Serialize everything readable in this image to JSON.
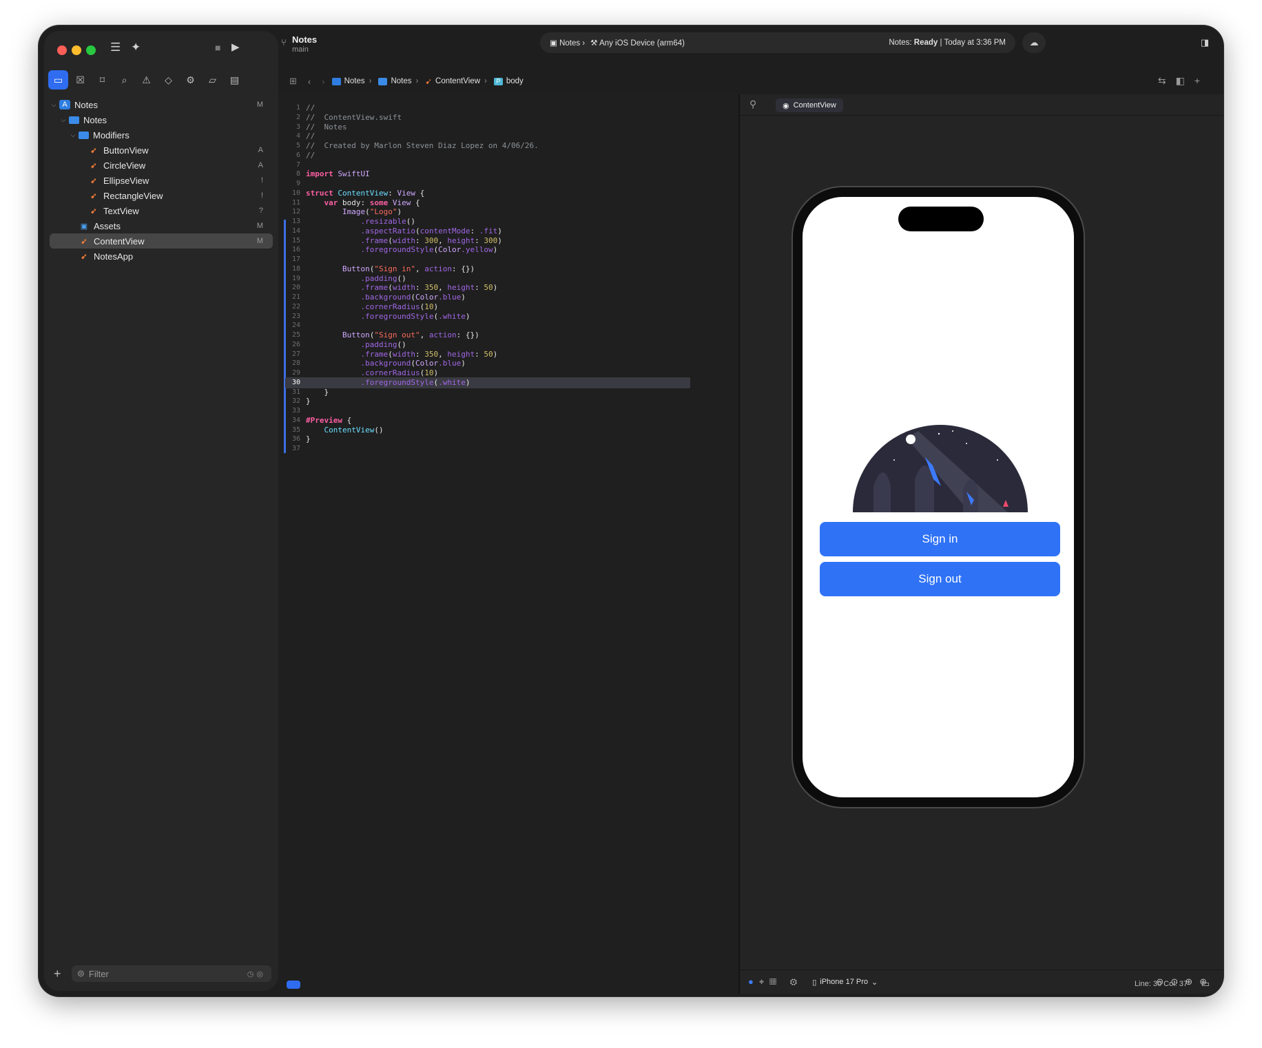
{
  "window": {
    "title": "Notes"
  },
  "toolbar": {
    "scheme_name": "Notes",
    "branch": "main",
    "target_app": "Notes",
    "destination": "Any iOS Device (arm64)",
    "status_prefix": "Notes:",
    "status_state": "Ready",
    "status_time": "| Today at 3:36 PM"
  },
  "navigator": {
    "items": [
      {
        "label": "Notes",
        "badge": "M"
      },
      {
        "label": "Notes",
        "badge": ""
      },
      {
        "label": "Modifiers",
        "badge": ""
      },
      {
        "label": "ButtonView",
        "badge": "A"
      },
      {
        "label": "CircleView",
        "badge": "A"
      },
      {
        "label": "EllipseView",
        "badge": "!"
      },
      {
        "label": "RectangleView",
        "badge": "!"
      },
      {
        "label": "TextView",
        "badge": "?"
      },
      {
        "label": "Assets",
        "badge": "M"
      },
      {
        "label": "ContentView",
        "badge": "M"
      },
      {
        "label": "NotesApp",
        "badge": ""
      }
    ],
    "filter_placeholder": "Filter"
  },
  "jumpbar": {
    "crumbs": [
      "Notes",
      "Notes",
      "ContentView",
      "body"
    ]
  },
  "editor": {
    "current_line": "30",
    "lines": [
      "//",
      "//  ContentView.swift",
      "//  Notes",
      "//",
      "//  Created by Marlon Steven Diaz Lopez on 4/06/26.",
      "//",
      "",
      "import SwiftUI",
      "",
      "struct ContentView: View {",
      "    var body: some View {",
      "        Image(\"Logo\")",
      "            .resizable()",
      "            .aspectRatio(contentMode: .fit)",
      "            .frame(width: 300, height: 300)",
      "            .foregroundStyle(Color.yellow)",
      "",
      "        Button(\"Sign in\", action: {})",
      "            .padding()",
      "            .frame(width: 350, height: 50)",
      "            .background(Color.blue)",
      "            .cornerRadius(10)",
      "            .foregroundStyle(.white)",
      "",
      "        Button(\"Sign out\", action: {})",
      "            .padding()",
      "            .frame(width: 350, height: 50)",
      "            .background(Color.blue)",
      "            .cornerRadius(10)",
      "            .foregroundStyle(.white)",
      "    }",
      "}",
      "",
      "#Preview {",
      "    ContentView()",
      "}",
      ""
    ]
  },
  "canvas": {
    "preview_tab": "ContentView",
    "device": "iPhone 17 Pro",
    "buttons": {
      "sign_in": "Sign in",
      "sign_out": "Sign out"
    }
  },
  "statusbar": {
    "position": "Line: 30  Col: 37"
  },
  "colors": {
    "accent": "#2f6cf0",
    "button": "#2f72f6",
    "background": "#1e1e1e"
  }
}
